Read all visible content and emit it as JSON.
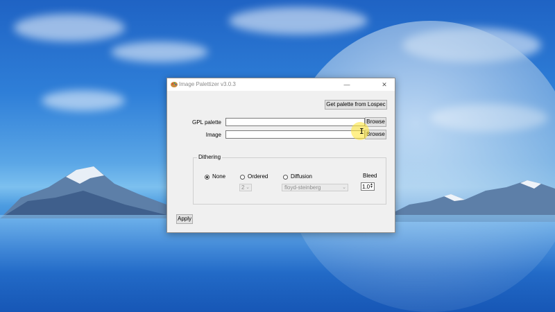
{
  "window": {
    "title": "Image Palettizer v3.0.3",
    "minimize_glyph": "—",
    "close_glyph": "✕"
  },
  "toolbar": {
    "lospec_button": "Get palette from Lospec"
  },
  "form": {
    "gpl_label": "GPL palette",
    "gpl_value": "",
    "gpl_browse": "Browse",
    "image_label": "Image",
    "image_value": "",
    "image_browse": "Browse"
  },
  "dithering": {
    "group_title": "Dithering",
    "none_label": "None",
    "ordered_label": "Ordered",
    "diffusion_label": "Diffusion",
    "selected": "None",
    "ordered_value": "2",
    "diffusion_value": "floyd-steinberg",
    "bleed_label": "Bleed",
    "bleed_value": "1.0"
  },
  "actions": {
    "apply_label": "Apply"
  },
  "icons": {
    "app": "palette-icon",
    "cursor": "text-cursor-icon"
  },
  "colors": {
    "window_bg": "#f0f0f0",
    "desktop_sky": "#2f7fd8",
    "cursor_highlight": "#ffe63c"
  }
}
